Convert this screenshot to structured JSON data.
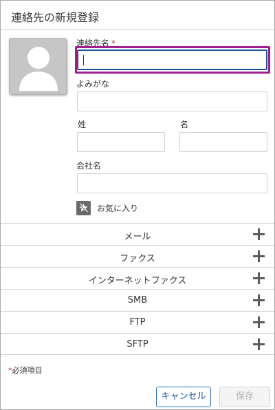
{
  "dialog": {
    "title": "連絡先の新規登録"
  },
  "form": {
    "name_label": "連絡先名",
    "required_mark": "*",
    "name_value": "",
    "furigana_label": "よみがな",
    "furigana_value": "",
    "last_name_label": "姓",
    "last_name_value": "",
    "first_name_label": "名",
    "first_name_value": "",
    "company_label": "会社名",
    "company_value": "",
    "favorite_label": "お気に入り"
  },
  "sections": [
    {
      "label": "メール",
      "icon": "plus-icon"
    },
    {
      "label": "ファクス",
      "icon": "plus-icon"
    },
    {
      "label": "インターネットファクス",
      "icon": "plus-icon"
    },
    {
      "label": "SMB",
      "icon": "plus-icon"
    },
    {
      "label": "FTP",
      "icon": "plus-icon"
    },
    {
      "label": "SFTP",
      "icon": "plus-icon"
    }
  ],
  "footer": {
    "required_star": "*",
    "required_note": "必須項目",
    "cancel_label": "キャンセル",
    "save_label": "保存"
  },
  "colors": {
    "focus_ring": "#a21e8c",
    "input_focus": "#1b5297",
    "required": "#c23934",
    "cancel_text": "#1e5aa0"
  }
}
